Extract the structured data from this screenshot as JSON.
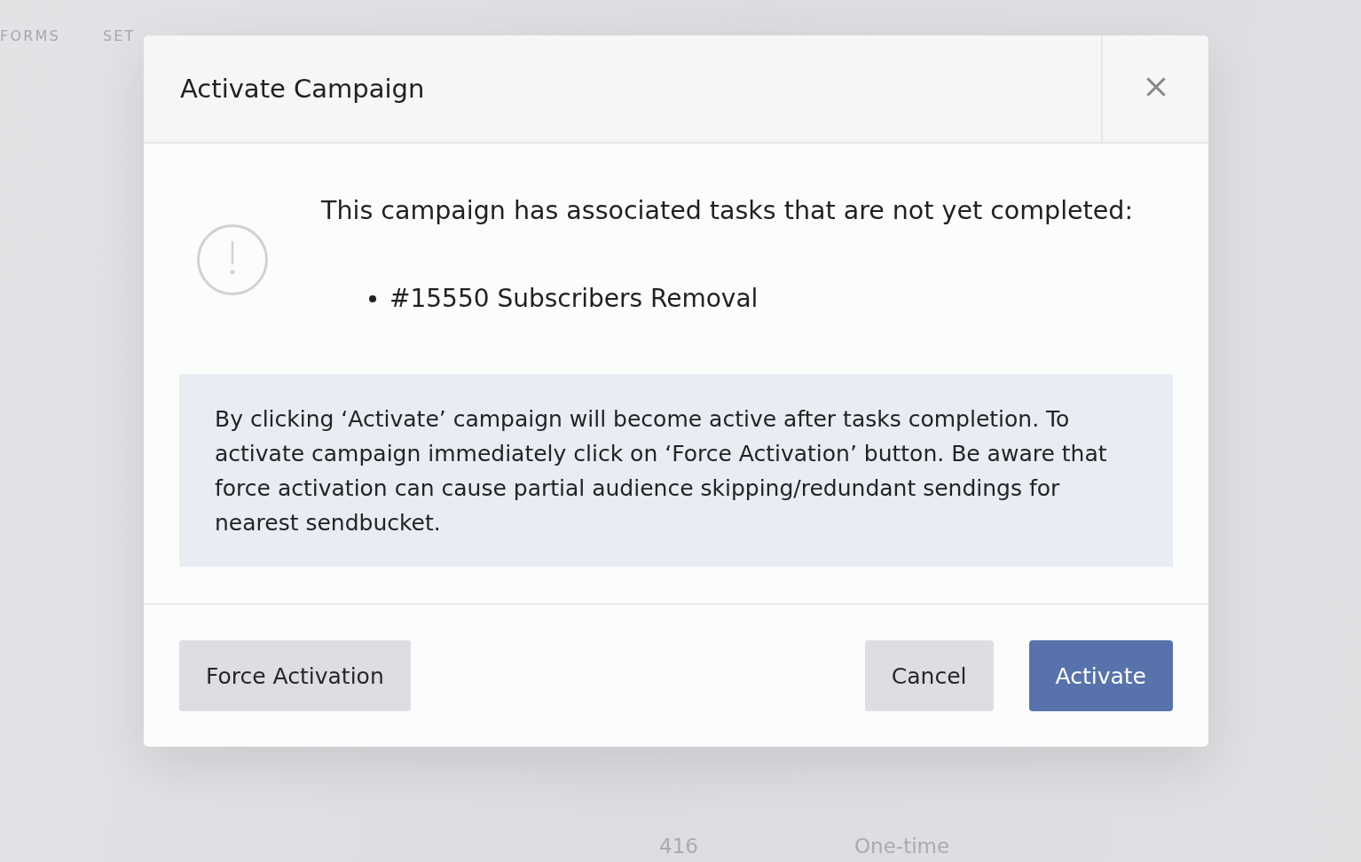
{
  "background": {
    "nav": [
      "FORMS",
      "SET"
    ],
    "table_row": [
      "416",
      "One-time"
    ]
  },
  "dialog": {
    "title": "Activate Campaign",
    "message": "This campaign has associated tasks that are not yet completed:",
    "tasks": [
      "#15550 Subscribers Removal"
    ],
    "notice": "By clicking ‘Activate’ campaign will become active after tasks completion. To activate campaign immediately click on ‘Force Activation’ button. Be aware that force activation can cause partial audience skipping/redundant sendings for nearest sendbucket.",
    "buttons": [
      {
        "label": "Force Activation",
        "kind": "secondary"
      },
      {
        "label": "Cancel",
        "kind": "secondary"
      },
      {
        "label": "Activate",
        "kind": "primary"
      }
    ]
  }
}
